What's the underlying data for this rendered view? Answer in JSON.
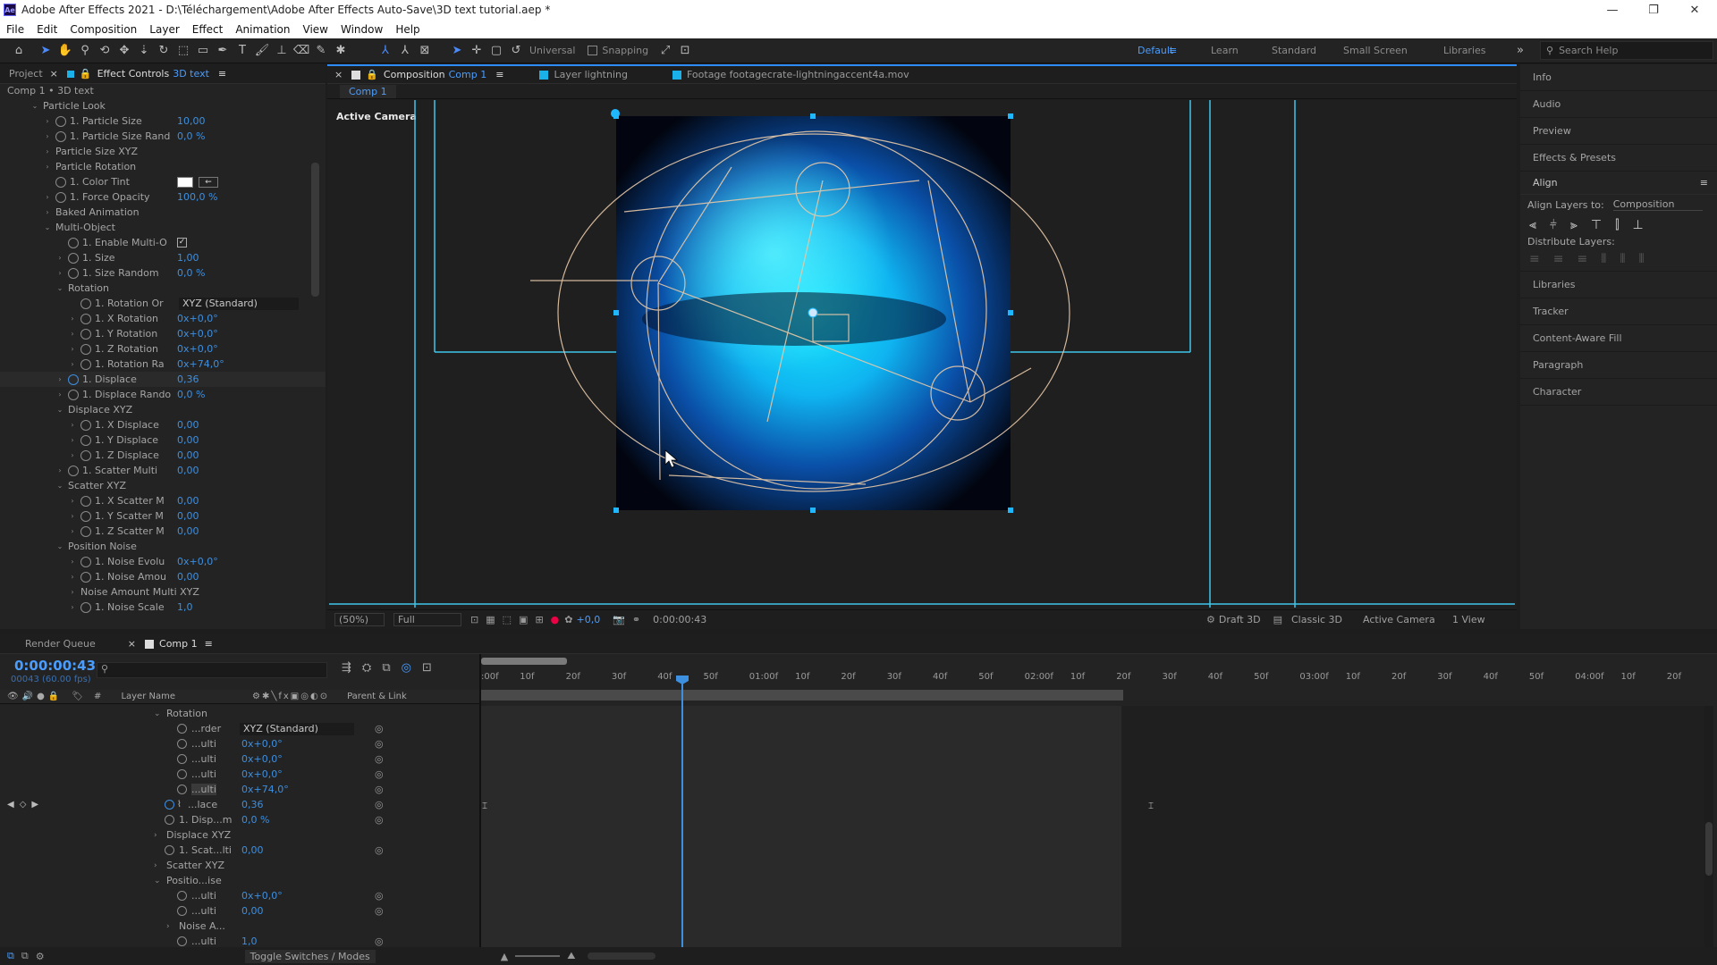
{
  "app": {
    "title": "Adobe After Effects 2021 - D:\\Téléchargement\\Adobe After Effects Auto-Save\\3D text tutorial.aep *",
    "logo": "Ae"
  },
  "menu": [
    "File",
    "Edit",
    "Composition",
    "Layer",
    "Effect",
    "Animation",
    "View",
    "Window",
    "Help"
  ],
  "toolbar": {
    "universal_label": "Universal",
    "snapping_label": "Snapping",
    "workspaces": [
      "Default",
      "Learn",
      "Standard",
      "Small Screen",
      "Libraries"
    ],
    "active_workspace": "Default",
    "search_placeholder": "Search Help"
  },
  "left_panel": {
    "tab_project": "Project",
    "tab_effect": "Effect Controls",
    "tab_effect_layer": "3D text",
    "breadcrumb": "Comp 1 • 3D text",
    "rows": [
      {
        "indent": 2,
        "tw": "v",
        "sw": false,
        "label": "Particle Look",
        "value": ""
      },
      {
        "indent": 3,
        "tw": ">",
        "sw": true,
        "label": "1. Particle Size",
        "value": "10,00"
      },
      {
        "indent": 3,
        "tw": ">",
        "sw": true,
        "label": "1. Particle Size Rand",
        "value": "0,0 %"
      },
      {
        "indent": 3,
        "tw": ">",
        "sw": false,
        "label": "Particle Size XYZ",
        "value": ""
      },
      {
        "indent": 3,
        "tw": ">",
        "sw": false,
        "label": "Particle Rotation",
        "value": ""
      },
      {
        "indent": 3,
        "tw": " ",
        "sw": true,
        "label": "1. Color Tint",
        "value": "",
        "color": true
      },
      {
        "indent": 3,
        "tw": ">",
        "sw": true,
        "label": "1. Force Opacity",
        "value": "100,0 %"
      },
      {
        "indent": 3,
        "tw": ">",
        "sw": false,
        "label": "Baked Animation",
        "value": ""
      },
      {
        "indent": 3,
        "tw": "v",
        "sw": false,
        "label": "Multi-Object",
        "value": ""
      },
      {
        "indent": 4,
        "tw": " ",
        "sw": true,
        "label": "1. Enable Multi-O",
        "value": "",
        "check": true
      },
      {
        "indent": 4,
        "tw": ">",
        "sw": true,
        "label": "1. Size",
        "value": "1,00"
      },
      {
        "indent": 4,
        "tw": ">",
        "sw": true,
        "label": "1. Size Random",
        "value": "0,0 %"
      },
      {
        "indent": 4,
        "tw": "v",
        "sw": false,
        "label": "Rotation",
        "value": ""
      },
      {
        "indent": 5,
        "tw": " ",
        "sw": true,
        "label": "1. Rotation Or",
        "value": "",
        "dropdown": "XYZ (Standard)"
      },
      {
        "indent": 5,
        "tw": ">",
        "sw": true,
        "label": "1. X Rotation",
        "value": "0x+0,0°"
      },
      {
        "indent": 5,
        "tw": ">",
        "sw": true,
        "label": "1. Y Rotation",
        "value": "0x+0,0°"
      },
      {
        "indent": 5,
        "tw": ">",
        "sw": true,
        "label": "1. Z Rotation",
        "value": "0x+0,0°"
      },
      {
        "indent": 5,
        "tw": ">",
        "sw": true,
        "label": "1. Rotation Ra",
        "value": "0x+74,0°"
      },
      {
        "indent": 4,
        "tw": ">",
        "sw": true,
        "label": "1. Displace",
        "value": "0,36",
        "hl": true
      },
      {
        "indent": 4,
        "tw": ">",
        "sw": true,
        "label": "1. Displace Rando",
        "value": "0,0 %"
      },
      {
        "indent": 4,
        "tw": "v",
        "sw": false,
        "label": "Displace XYZ",
        "value": ""
      },
      {
        "indent": 5,
        "tw": ">",
        "sw": true,
        "label": "1. X Displace",
        "value": "0,00"
      },
      {
        "indent": 5,
        "tw": ">",
        "sw": true,
        "label": "1. Y Displace",
        "value": "0,00"
      },
      {
        "indent": 5,
        "tw": ">",
        "sw": true,
        "label": "1. Z Displace",
        "value": "0,00"
      },
      {
        "indent": 4,
        "tw": ">",
        "sw": true,
        "label": "1. Scatter Multi",
        "value": "0,00"
      },
      {
        "indent": 4,
        "tw": "v",
        "sw": false,
        "label": "Scatter XYZ",
        "value": ""
      },
      {
        "indent": 5,
        "tw": ">",
        "sw": true,
        "label": "1. X Scatter M",
        "value": "0,00"
      },
      {
        "indent": 5,
        "tw": ">",
        "sw": true,
        "label": "1. Y Scatter M",
        "value": "0,00"
      },
      {
        "indent": 5,
        "tw": ">",
        "sw": true,
        "label": "1. Z Scatter M",
        "value": "0,00"
      },
      {
        "indent": 4,
        "tw": "v",
        "sw": false,
        "label": "Position Noise",
        "value": ""
      },
      {
        "indent": 5,
        "tw": ">",
        "sw": true,
        "label": "1. Noise Evolu",
        "value": "0x+0,0°"
      },
      {
        "indent": 5,
        "tw": ">",
        "sw": true,
        "label": "1. Noise Amou",
        "value": "0,00"
      },
      {
        "indent": 5,
        "tw": ">",
        "sw": false,
        "label": "Noise Amount Multi XYZ",
        "value": ""
      },
      {
        "indent": 5,
        "tw": ">",
        "sw": true,
        "label": "1. Noise Scale",
        "value": "1,0"
      }
    ]
  },
  "comp_panel": {
    "tab_comp_prefix": "Composition",
    "tab_comp_name": "Comp 1",
    "tab_layer": "Layer lightning",
    "tab_footage": "Footage footagecrate-lightningaccent4a.mov",
    "subtab": "Comp 1",
    "active_camera_label": "Active Camera",
    "zoom": "(50%)",
    "resolution": "Full",
    "exposure": "+0,0",
    "timecode": "0:00:00:43",
    "draft3d": "Draft 3D",
    "renderer": "Classic 3D",
    "camera": "Active Camera",
    "views": "1 View"
  },
  "right_panel": {
    "items_top": [
      "Info",
      "Audio",
      "Preview",
      "Effects & Presets"
    ],
    "align_title": "Align",
    "align_to_label": "Align Layers to:",
    "align_to_value": "Composition",
    "distribute_label": "Distribute Layers:",
    "items_bottom": [
      "Libraries",
      "Tracker",
      "Content-Aware Fill",
      "Paragraph",
      "Character"
    ]
  },
  "timeline": {
    "tab_render": "Render Queue",
    "tab_comp": "Comp 1",
    "timecode": "0:00:00:43",
    "frame_info": "00043 (60.00 fps)",
    "col_layer_name": "Layer Name",
    "col_parent": "Parent & Link",
    "ruler_labels": [
      ":00f",
      "10f",
      "20f",
      "30f",
      "40f",
      "50f",
      "01:00f",
      "10f",
      "20f",
      "30f",
      "40f",
      "50f",
      "02:00f",
      "10f",
      "20f",
      "30f",
      "40f",
      "50f",
      "03:00f",
      "10f",
      "20f",
      "30f",
      "40f",
      "50f",
      "04:00f",
      "10f",
      "20f"
    ],
    "rows": [
      {
        "indent": 0,
        "tw": "v",
        "sw": false,
        "label": "Rotation",
        "value": ""
      },
      {
        "indent": 1,
        "tw": " ",
        "sw": true,
        "label": "...rder",
        "value": "",
        "dropdown": "XYZ (Standard)",
        "link": true
      },
      {
        "indent": 1,
        "tw": " ",
        "sw": true,
        "label": "...ulti",
        "value": "0x+0,0°",
        "link": true
      },
      {
        "indent": 1,
        "tw": " ",
        "sw": true,
        "label": "...ulti",
        "value": "0x+0,0°",
        "link": true
      },
      {
        "indent": 1,
        "tw": " ",
        "sw": true,
        "label": "...ulti",
        "value": "0x+0,0°",
        "link": true
      },
      {
        "indent": 1,
        "tw": " ",
        "sw": true,
        "label": "...ulti",
        "value": "0x+74,0°",
        "link": true,
        "sel": true
      },
      {
        "indent": 0,
        "tw": " ",
        "sw": true,
        "label": "...lace",
        "value": "0,36",
        "link": true,
        "graph": true,
        "kf": true
      },
      {
        "indent": 0,
        "tw": " ",
        "sw": true,
        "label": "1. Disp...m",
        "value": "0,0 %",
        "link": true
      },
      {
        "indent": 0,
        "tw": ">",
        "sw": false,
        "label": "Displace XYZ",
        "value": ""
      },
      {
        "indent": 0,
        "tw": " ",
        "sw": true,
        "label": "1. Scat...lti",
        "value": "0,00",
        "link": true
      },
      {
        "indent": 0,
        "tw": ">",
        "sw": false,
        "label": "Scatter XYZ",
        "value": ""
      },
      {
        "indent": 0,
        "tw": "v",
        "sw": false,
        "label": "Positio...ise",
        "value": ""
      },
      {
        "indent": 1,
        "tw": " ",
        "sw": true,
        "label": "...ulti",
        "value": "0x+0,0°",
        "link": true
      },
      {
        "indent": 1,
        "tw": " ",
        "sw": true,
        "label": "...ulti",
        "value": "0,00",
        "link": true
      },
      {
        "indent": 1,
        "tw": ">",
        "sw": false,
        "label": "Noise A...",
        "value": ""
      },
      {
        "indent": 1,
        "tw": " ",
        "sw": true,
        "label": "...ulti",
        "value": "1,0",
        "link": true
      }
    ],
    "toggle_label": "Toggle Switches / Modes"
  },
  "colors": {
    "accent": "#2d8cff",
    "value_blue": "#3d8fe0",
    "comp_tab_square": "#1ab0e8"
  }
}
